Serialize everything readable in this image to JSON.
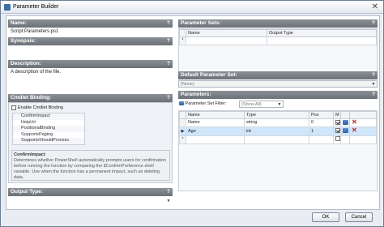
{
  "window": {
    "title": "Parameter Builder",
    "close_glyph": "✕"
  },
  "left": {
    "name": {
      "label": "Name:",
      "help": "?",
      "value": "Script:Parameters.ps1"
    },
    "synopsis": {
      "label": "Synopsis:",
      "help": "?",
      "value": ""
    },
    "description": {
      "label": "Description:",
      "help": "?",
      "value": "A description of the file."
    },
    "cmdlet_binding": {
      "label": "Cmdlet Binding:",
      "help": "?",
      "enable_label": "Enable Cmdlet Binding",
      "items": [
        "ConfirmImpact",
        "HelpUri",
        "PositionalBinding",
        "SupportsPaging",
        "SupportsShouldProcess"
      ],
      "desc_title": "ConfirmImpact",
      "desc_text": "Determines whether PowerShell automatically prompts users for confirmation before running the function by comparing the $ConfirmPreference shell variable. Use when the function has a permanent impact, such as deleting data."
    },
    "output_type": {
      "label": "Output Type:",
      "help": "?",
      "value": ""
    }
  },
  "right": {
    "parameter_sets": {
      "label": "Parameter Sets:",
      "help": "?",
      "columns": [
        "Name",
        "Output Type"
      ],
      "new_row_marker": "*"
    },
    "default_parameter_set": {
      "label": "Default Parameter Set:",
      "help": "?",
      "value": "(None)"
    },
    "parameters": {
      "label": "Parameters:",
      "help": "?",
      "filter_label": "Parameter Set Filter:",
      "filter_value": "(Show All)",
      "columns": [
        "Name",
        "Type",
        "Pos",
        "M"
      ],
      "rows": [
        {
          "marker": "",
          "name": "Name",
          "type": "string",
          "pos": "0",
          "mandatory": true
        },
        {
          "marker": "▶",
          "name": "Age",
          "type": "int",
          "pos": "1",
          "mandatory": true
        }
      ],
      "new_row_marker": "*"
    }
  },
  "buttons": {
    "ok": "OK",
    "cancel": "Cancel"
  }
}
